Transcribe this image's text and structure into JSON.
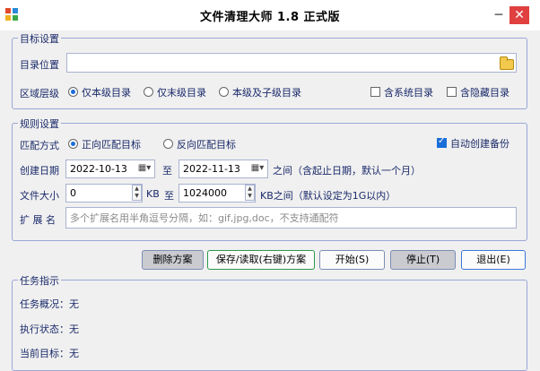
{
  "window": {
    "title": "文件清理大师 1.8 正式版",
    "minimize": "─",
    "close": "✕"
  },
  "target_settings": {
    "legend": "目标设置",
    "dir_label": "目录位置",
    "dir_value": "",
    "scope_label": "区域层级",
    "scope_options": [
      "仅本级目录",
      "仅末级目录",
      "本级及子级目录"
    ],
    "scope_selected": 0,
    "include_system": {
      "label": "含系统目录",
      "checked": false
    },
    "include_hidden": {
      "label": "含隐藏目录",
      "checked": false
    }
  },
  "rule_settings": {
    "legend": "规则设置",
    "match_label": "匹配方式",
    "match_options": [
      "正向匹配目标",
      "反向匹配目标"
    ],
    "match_selected": 0,
    "auto_backup": {
      "label": "自动创建备份",
      "checked": true
    },
    "date_label": "创建日期",
    "date_from": "2022-10-13",
    "date_to_label": "至",
    "date_to": "2022-11-13",
    "date_note": "之间（含起止日期，默认一个月）",
    "size_label": "文件大小",
    "size_from": "0",
    "size_unit_1": "KB",
    "size_to_label": "至",
    "size_to": "1024000",
    "size_note": "KB之间（默认设定为1G以内）",
    "ext_label": "扩 展 名",
    "ext_value": "",
    "ext_placeholder": "多个扩展名用半角逗号分隔，如：gif,jpg,doc，不支持通配符"
  },
  "buttons": {
    "delete": "删除方案",
    "save_load": "保存/读取(右键)方案",
    "start": "开始(S)",
    "stop": "停止(T)",
    "exit": "退出(E)"
  },
  "task": {
    "legend": "任务指示",
    "overview": "任务概况：无",
    "status": "执行状态：无",
    "current": "当前目标：无"
  }
}
